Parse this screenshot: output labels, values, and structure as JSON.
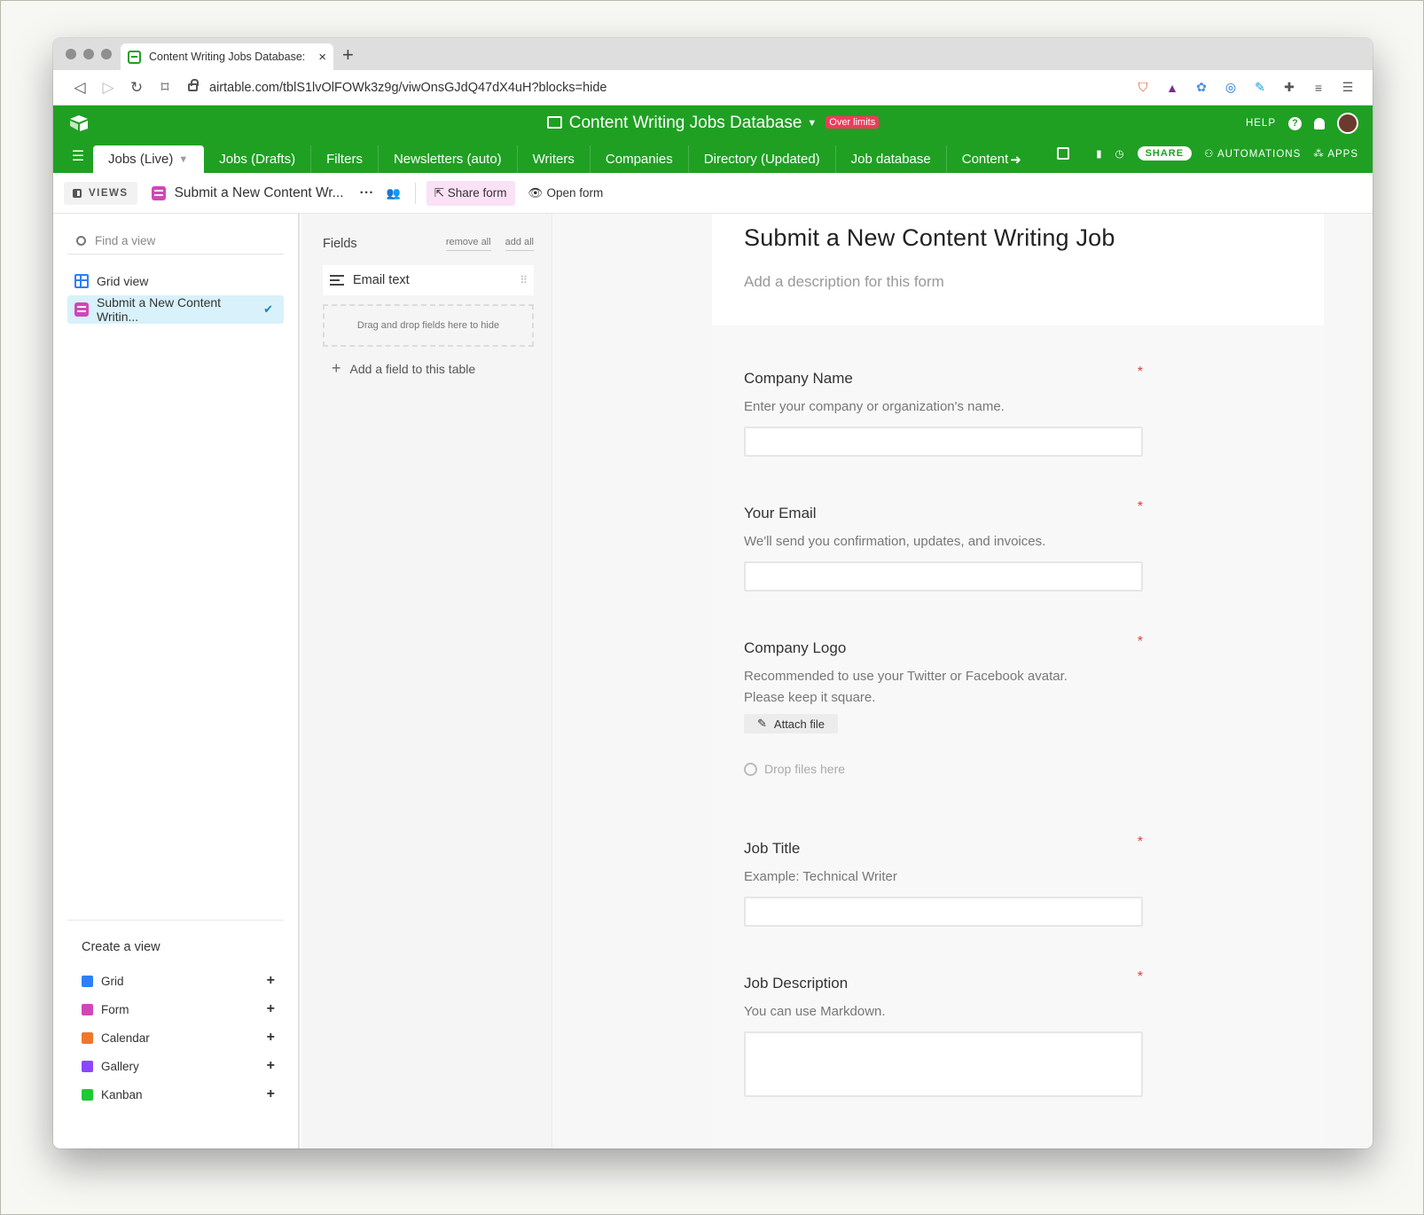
{
  "browser": {
    "tab_title": "Content Writing Jobs Database:",
    "tab_close": "×",
    "new_tab": "+",
    "url": "airtable.com/tblS1lvOlFOWk3z9g/viwOnsGJdQ47dX4uH?blocks=hide"
  },
  "appbar": {
    "base_title": "Content Writing Jobs Database",
    "over_limits": "Over limits",
    "help": "HELP"
  },
  "tables": [
    {
      "label": "Jobs (Live)"
    },
    {
      "label": "Jobs (Drafts)"
    },
    {
      "label": "Filters"
    },
    {
      "label": "Newsletters (auto)"
    },
    {
      "label": "Writers"
    },
    {
      "label": "Companies"
    },
    {
      "label": "Directory (Updated)"
    },
    {
      "label": "Job database"
    },
    {
      "label": "Content"
    }
  ],
  "tablebar": {
    "share": "SHARE",
    "automations": "AUTOMATIONS",
    "apps": "APPS"
  },
  "viewbar": {
    "views_label": "VIEWS",
    "current_view": "Submit a New Content Wr...",
    "share_form": "Share form",
    "open_form": "Open form"
  },
  "sidebar": {
    "search_placeholder": "Find a view",
    "views": [
      {
        "label": "Grid view"
      },
      {
        "label": "Submit a New Content Writin..."
      }
    ],
    "create_title": "Create a view",
    "create_items": [
      {
        "label": "Grid",
        "color": "#2d7ff9"
      },
      {
        "label": "Form",
        "color": "#d147b8"
      },
      {
        "label": "Calendar",
        "color": "#f0762a"
      },
      {
        "label": "Gallery",
        "color": "#8b46ff"
      },
      {
        "label": "Kanban",
        "color": "#20c933"
      }
    ]
  },
  "fields_panel": {
    "title": "Fields",
    "remove_all": "remove all",
    "add_all": "add all",
    "hidden_fields": [
      {
        "label": "Email text"
      }
    ],
    "drop_hint": "Drag and drop fields here to hide",
    "add_field": "Add a field to this table"
  },
  "form": {
    "title": "Submit a New Content Writing Job",
    "description_placeholder": "Add a description for this form",
    "required_mark": "*",
    "fields": {
      "company_name": {
        "label": "Company Name",
        "help": "Enter your company or organization's name."
      },
      "email": {
        "label": "Your Email",
        "help": "We'll send you confirmation, updates, and invoices."
      },
      "logo": {
        "label": "Company Logo",
        "help1": "Recommended to use your Twitter or Facebook avatar.",
        "help2": "Please keep it square.",
        "attach": "Attach file",
        "drop": "Drop files here"
      },
      "job_title": {
        "label": "Job Title",
        "help": "Example: Technical Writer"
      },
      "job_description": {
        "label": "Job Description",
        "help": "You can use Markdown."
      }
    }
  },
  "colors": {
    "brand_green": "#1fa023",
    "form_pink": "#d147b8",
    "grid_blue": "#2d7ff9",
    "required_red": "#e03e3e"
  }
}
